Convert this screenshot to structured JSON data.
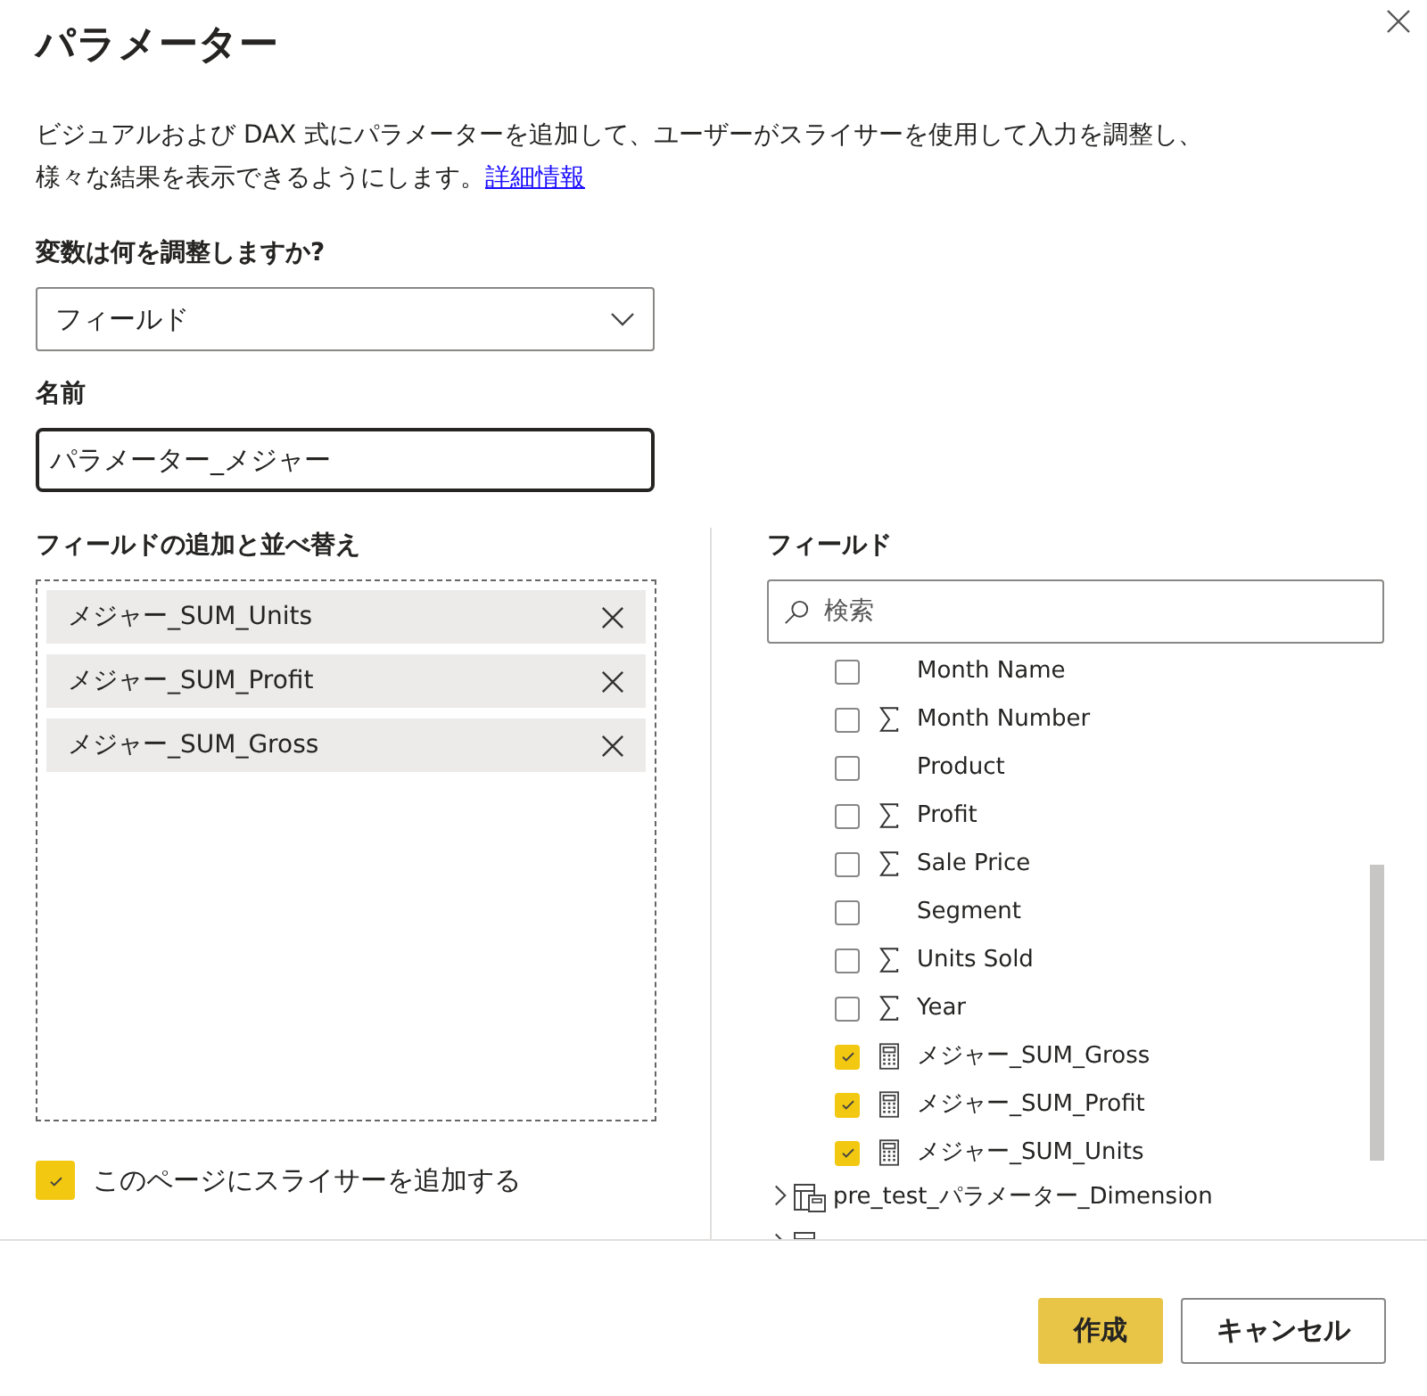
{
  "dialog": {
    "title": "パラメーター",
    "description": [
      "ビジュアルおよび DAX 式にパラメーターを追加して、ユーザーがスライサーを使用して入力を調整し、",
      "様々な結果を表示できるようにします。"
    ],
    "link": "詳細情報"
  },
  "variable": {
    "label": "変数は何を調整しますか?",
    "value": "フィールド"
  },
  "name": {
    "label": "名前",
    "value": "パラメーター_メジャー"
  },
  "added": {
    "label": "フィールドの追加と並べ替え",
    "items": [
      "メジャー_SUM_Units",
      "メジャー_SUM_Profit",
      "メジャー_SUM_Gross"
    ]
  },
  "slicer": {
    "label": "このページにスライサーを追加する",
    "checked": true
  },
  "fields": {
    "label": "フィールド",
    "search": {
      "placeholder": "検索"
    },
    "items": [
      {
        "kind": "column",
        "label": "Month Name",
        "checked": false
      },
      {
        "kind": "sum",
        "label": "Month Number",
        "checked": false
      },
      {
        "kind": "column",
        "label": "Product",
        "checked": false
      },
      {
        "kind": "sum",
        "label": "Profit",
        "checked": false
      },
      {
        "kind": "sum",
        "label": "Sale Price",
        "checked": false
      },
      {
        "kind": "column",
        "label": "Segment",
        "checked": false
      },
      {
        "kind": "sum",
        "label": "Units Sold",
        "checked": false
      },
      {
        "kind": "sum",
        "label": "Year",
        "checked": false
      },
      {
        "kind": "measure",
        "label": "メジャー_SUM_Gross",
        "checked": true
      },
      {
        "kind": "measure",
        "label": "メジャー_SUM_Profit",
        "checked": true
      },
      {
        "kind": "measure",
        "label": "メジャー_SUM_Units",
        "checked": true
      }
    ],
    "tables": [
      {
        "label": "pre_test_パラメーター_Dimension",
        "expanded": false
      },
      {
        "expanded": false
      }
    ]
  },
  "buttons": [
    "作成",
    "キャンセル"
  ]
}
